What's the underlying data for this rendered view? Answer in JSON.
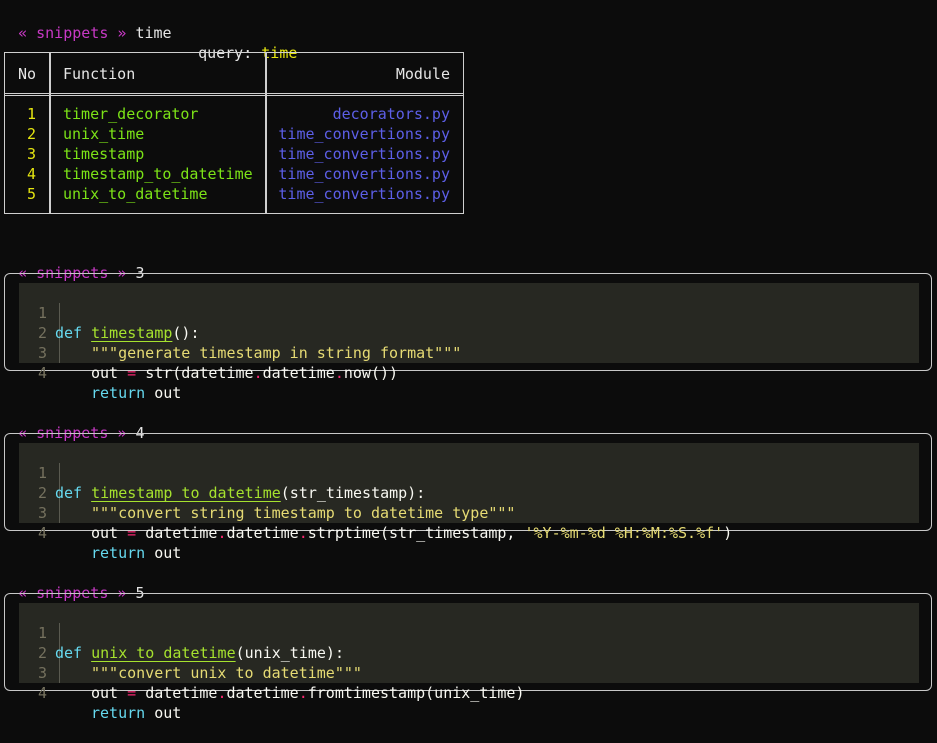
{
  "search_prompt": {
    "open": "«",
    "app": "snippets",
    "sep": "»",
    "arg": "time"
  },
  "query_line": {
    "label": "query:",
    "value": "time"
  },
  "results_table": {
    "headers": {
      "no": "No",
      "function": "Function",
      "module": "Module"
    },
    "rows": [
      {
        "no": "1",
        "function": "timer_decorator",
        "module": "decorators.py"
      },
      {
        "no": "2",
        "function": "unix_time",
        "module": "time_convertions.py"
      },
      {
        "no": "3",
        "function": "timestamp",
        "module": "time_convertions.py"
      },
      {
        "no": "4",
        "function": "timestamp_to_datetime",
        "module": "time_convertions.py"
      },
      {
        "no": "5",
        "function": "unix_to_datetime",
        "module": "time_convertions.py"
      }
    ]
  },
  "snippets": [
    {
      "prompt": {
        "open": "«",
        "app": "snippets",
        "sep": "»",
        "arg": "3"
      },
      "line_numbers": [
        "1",
        "2",
        "3",
        "4"
      ],
      "code": {
        "def": "def",
        "name": "timestamp",
        "params": "():",
        "docstring": "\"\"\"generate timestamp in string format\"\"\"",
        "assign_lhs": "out",
        "eq": "=",
        "rhs_pre": "str(datetime",
        "dot1": ".",
        "rhs_mid": "datetime",
        "dot2": ".",
        "rhs_post": "now())",
        "rhs_str": "",
        "rhs_end": "",
        "return_kw": "return",
        "return_val": "out"
      }
    },
    {
      "prompt": {
        "open": "«",
        "app": "snippets",
        "sep": "»",
        "arg": "4"
      },
      "line_numbers": [
        "1",
        "2",
        "3",
        "4"
      ],
      "code": {
        "def": "def",
        "name": "timestamp_to_datetime",
        "params": "(str_timestamp):",
        "docstring": "\"\"\"convert string timestamp to datetime type\"\"\"",
        "assign_lhs": "out",
        "eq": "=",
        "rhs_pre": "datetime",
        "dot1": ".",
        "rhs_mid": "datetime",
        "dot2": ".",
        "rhs_post": "strptime(str_timestamp, ",
        "rhs_str": "'%Y-%m-%d %H:%M:%S.%f'",
        "rhs_end": ")",
        "return_kw": "return",
        "return_val": "out"
      }
    },
    {
      "prompt": {
        "open": "«",
        "app": "snippets",
        "sep": "»",
        "arg": "5"
      },
      "line_numbers": [
        "1",
        "2",
        "3",
        "4"
      ],
      "code": {
        "def": "def",
        "name": "unix_to_datetime",
        "params": "(unix_time):",
        "docstring": "\"\"\"convert unix to datetime\"\"\"",
        "assign_lhs": "out",
        "eq": "=",
        "rhs_pre": "datetime",
        "dot1": ".",
        "rhs_mid": "datetime",
        "dot2": ".",
        "rhs_post": "fromtimestamp(unix_time)",
        "rhs_str": "",
        "rhs_end": "",
        "return_kw": "return",
        "return_val": "out"
      }
    }
  ],
  "colors": {
    "background": "#0c0c0c",
    "prompt_magenta": "#c839c5",
    "row_number_yellow": "#e5e510",
    "function_green": "#7ce317",
    "module_blue": "#5d5fe8",
    "code_background": "#272822"
  }
}
